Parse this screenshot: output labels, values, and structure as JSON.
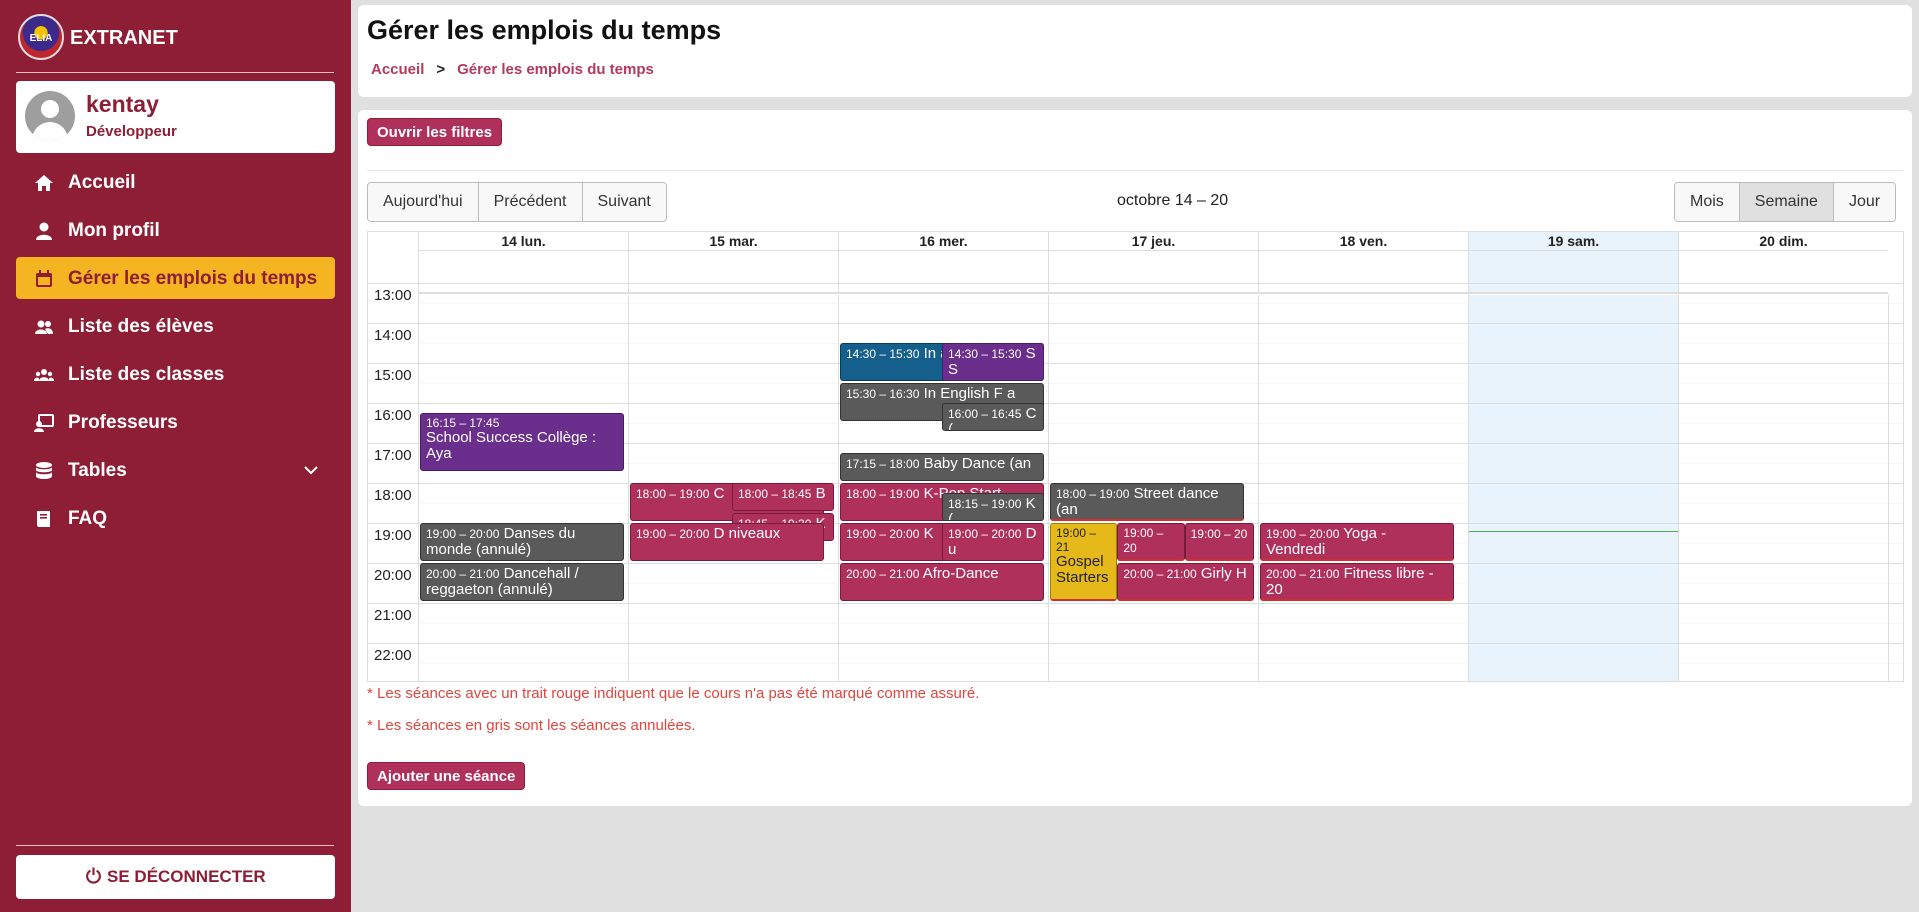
{
  "app": {
    "brand": "EXTRANET",
    "logo_text": "ELIA"
  },
  "user": {
    "name": "kentay",
    "role": "Développeur"
  },
  "nav": [
    {
      "label": "Accueil",
      "icon": "home-icon"
    },
    {
      "label": "Mon profil",
      "icon": "user-icon"
    },
    {
      "label": "Gérer les emplois du temps",
      "icon": "calendar-icon",
      "active": true
    },
    {
      "label": "Liste des élèves",
      "icon": "users-icon"
    },
    {
      "label": "Liste des classes",
      "icon": "group-icon"
    },
    {
      "label": "Professeurs",
      "icon": "teacher-icon"
    },
    {
      "label": "Tables",
      "icon": "database-icon",
      "expandable": true
    },
    {
      "label": "FAQ",
      "icon": "book-icon"
    }
  ],
  "logout": {
    "label": "SE DÉCONNECTER",
    "icon": "power-icon"
  },
  "page": {
    "title": "Gérer les emplois du temps",
    "breadcrumb": [
      "Accueil",
      "Gérer les emplois du temps"
    ],
    "breadcrumb_sep": ">"
  },
  "filters_button": "Ouvrir les filtres",
  "toolbar": {
    "today": "Aujourd'hui",
    "prev": "Précédent",
    "next": "Suivant",
    "title": "octobre 14 – 20",
    "views": [
      "Mois",
      "Semaine",
      "Jour"
    ],
    "active_view": "Semaine"
  },
  "days": [
    "14 lun.",
    "15 mar.",
    "16 mer.",
    "17 jeu.",
    "18 ven.",
    "19 sam.",
    "20 dim."
  ],
  "highlight_day": 5,
  "hours": [
    "13:00",
    "14:00",
    "15:00",
    "16:00",
    "17:00",
    "18:00",
    "19:00",
    "20:00",
    "21:00",
    "22:00"
  ],
  "events": [
    {
      "day": 0,
      "time": "16:15 – 17:45",
      "name": "School Success Collège : Aya",
      "color": "purple"
    },
    {
      "day": 0,
      "time": "19:00 – 20:00",
      "name": "Danses du monde (annulé)",
      "color": "gray"
    },
    {
      "day": 0,
      "time": "20:00 – 21:00",
      "name": "Dancehall / reggaeton (annulé)",
      "color": "gray"
    },
    {
      "day": 1,
      "time": "18:00 – 19:00",
      "name": "C",
      "color": "pink"
    },
    {
      "day": 1,
      "time": "18:00 – 18:45",
      "name": "B",
      "color": "pink"
    },
    {
      "day": 1,
      "time": "18:45 – 19:30",
      "name": "K",
      "color": "pink"
    },
    {
      "day": 1,
      "time": "19:00 – 20:00",
      "name": "D niveaux",
      "color": "pink"
    },
    {
      "day": 2,
      "time": "14:30 – 15:30",
      "name": "In a",
      "color": "blue"
    },
    {
      "day": 2,
      "time": "14:30 – 15:30",
      "name": "S S",
      "color": "purple"
    },
    {
      "day": 2,
      "time": "15:30 – 16:30",
      "name": "In English F a",
      "color": "gray"
    },
    {
      "day": 2,
      "time": "16:00 – 16:45",
      "name": "C (",
      "color": "gray"
    },
    {
      "day": 2,
      "time": "17:15 – 18:00",
      "name": "Baby Dance (an",
      "color": "gray"
    },
    {
      "day": 2,
      "time": "18:00 – 19:00",
      "name": "K-Pop Start",
      "color": "pink"
    },
    {
      "day": 2,
      "time": "18:15 – 19:00",
      "name": "K (",
      "color": "gray"
    },
    {
      "day": 2,
      "time": "19:00 – 20:00",
      "name": "K",
      "color": "pink"
    },
    {
      "day": 2,
      "time": "19:00 – 20:00",
      "name": "D u",
      "color": "pink"
    },
    {
      "day": 2,
      "time": "20:00 – 21:00",
      "name": "Afro-Dance",
      "color": "pink"
    },
    {
      "day": 3,
      "time": "18:00 – 19:00",
      "name": "Street dance (an",
      "color": "gray"
    },
    {
      "day": 3,
      "time": "19:00 – 21",
      "name": "Gospel Starters",
      "color": "yellow"
    },
    {
      "day": 3,
      "time": "19:00 – 20",
      "name": "",
      "color": "pink"
    },
    {
      "day": 3,
      "time": "19:00 – 20",
      "name": "",
      "color": "pink"
    },
    {
      "day": 3,
      "time": "20:00 – 21:00",
      "name": "Girly H",
      "color": "pink"
    },
    {
      "day": 4,
      "time": "19:00 – 20:00",
      "name": "Yoga - Vendredi",
      "color": "pink"
    },
    {
      "day": 4,
      "time": "20:00 – 21:00",
      "name": "Fitness libre - 20",
      "color": "pink"
    }
  ],
  "notes": [
    "* Les séances avec un trait rouge indiquent que le cours n'a pas été marqué comme assuré.",
    "* Les séances en gris sont les séances annulées."
  ],
  "add_button": "Ajouter une séance"
}
